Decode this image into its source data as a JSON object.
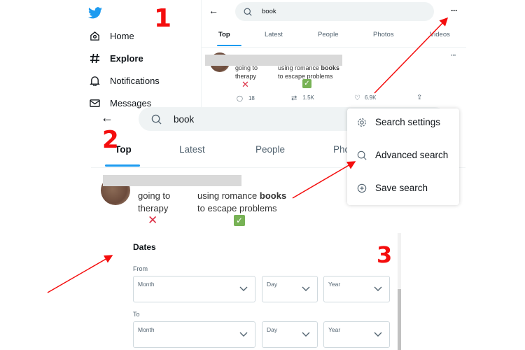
{
  "steps": [
    "1",
    "2",
    "3"
  ],
  "sidebar": {
    "items": [
      {
        "label": "Home",
        "icon": "home-icon"
      },
      {
        "label": "Explore",
        "icon": "hashtag-icon"
      },
      {
        "label": "Notifications",
        "icon": "bell-icon"
      },
      {
        "label": "Messages",
        "icon": "mail-icon"
      }
    ]
  },
  "search": {
    "query": "book"
  },
  "tabs": [
    "Top",
    "Latest",
    "People",
    "Photos",
    "Videos"
  ],
  "tabs_partial": "Pho",
  "tweet": {
    "left_lines": [
      "going to",
      "therapy"
    ],
    "right_pre": "using romance ",
    "right_bold": "books",
    "right_line2": "to escape problems",
    "replies": "18",
    "retweets": "1.5K",
    "likes": "6.9K"
  },
  "menu": {
    "items": [
      {
        "label": "Search settings",
        "icon": "gear-icon"
      },
      {
        "label": "Advanced search",
        "icon": "search-icon"
      },
      {
        "label": "Save search",
        "icon": "plus-circle-icon"
      }
    ]
  },
  "dates": {
    "title": "Dates",
    "from": "From",
    "to": "To",
    "month": "Month",
    "day": "Day",
    "year": "Year"
  },
  "colors": {
    "accent": "#1d9bf0",
    "annotation": "#f40d0d",
    "check": "#77b255"
  }
}
